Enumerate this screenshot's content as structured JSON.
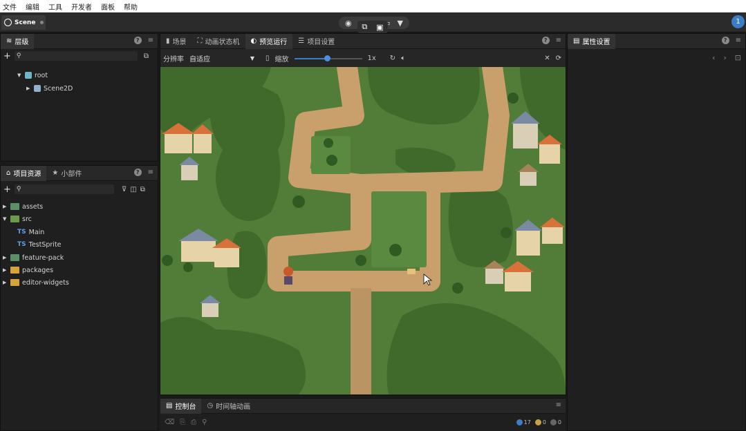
{
  "menu": {
    "items": [
      "文件",
      "编辑",
      "工具",
      "开发者",
      "面板",
      "帮助"
    ]
  },
  "toolbar": {
    "scene_tab": "Scene",
    "user_badge": "1"
  },
  "hierarchy": {
    "tab": "层级",
    "tree": [
      {
        "label": "root"
      },
      {
        "label": "Scene2D"
      }
    ]
  },
  "assets": {
    "tabs": [
      "项目资源",
      "小部件"
    ],
    "tree": [
      {
        "label": "assets",
        "color": "#5a8f6a"
      },
      {
        "label": "src",
        "color": "#6a9a4a"
      },
      {
        "prefix": "TS",
        "label": "Main"
      },
      {
        "prefix": "TS",
        "label": "TestSprite"
      },
      {
        "label": "feature-pack",
        "color": "#5a8f6a"
      },
      {
        "label": "packages",
        "color": "#d4a33a"
      },
      {
        "label": "editor-widgets",
        "color": "#d4a33a"
      }
    ]
  },
  "viewport": {
    "tabs": [
      "场景",
      "动画状态机",
      "预览运行",
      "项目设置"
    ],
    "resolution_label": "分辨率",
    "resolution_value": "自适应",
    "scale_label": "缩放",
    "scale_value": "1x",
    "scale_level": 0.48
  },
  "properties": {
    "tab": "属性设置"
  },
  "console": {
    "tabs": [
      "控制台",
      "时间轴动画"
    ],
    "counts": {
      "info": "17",
      "warn": "0",
      "error": "0"
    }
  },
  "colors": {
    "accent": "#3c7dc4",
    "panel_bg": "#1f1f1f",
    "header_bg": "#282828",
    "grass": "#4d7a36",
    "path": "#c9a06b"
  }
}
